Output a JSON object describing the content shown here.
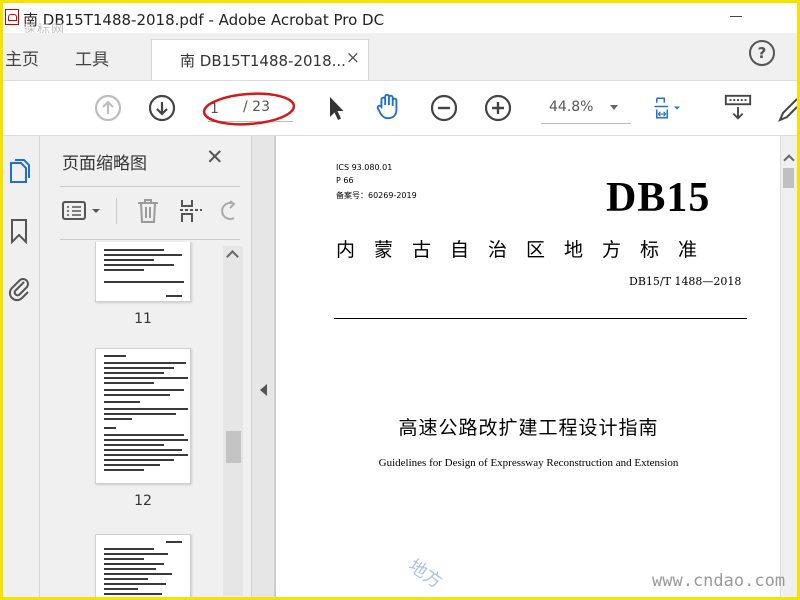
{
  "window": {
    "title": "南 DB15T1488-2018.pdf - Adobe Acrobat Pro DC",
    "watermark_top": "速标网"
  },
  "nav": {
    "home": "主页",
    "tools": "工具",
    "doc_tab": "南 DB15T1488-2018...",
    "doc_tab_close": "×",
    "help": "?"
  },
  "toolbar": {
    "page_current": "1",
    "page_total": "/ 23",
    "zoom": "44.8%"
  },
  "panel": {
    "title": "页面缩略图",
    "close": "✕",
    "thumbnails": [
      {
        "label": "11"
      },
      {
        "label": "12"
      },
      {
        "label": ""
      }
    ]
  },
  "document": {
    "ics": "ICS 93.080.01",
    "p": "P 66",
    "record": "备案号：60269-2019",
    "logo": "DB15",
    "region": "内蒙古自治区地方标准",
    "code": "DB15/T 1488—2018",
    "title_cn": "高速公路改扩建工程设计指南",
    "title_en": "Guidelines for Design of Expressway Reconstruction and Extension"
  },
  "watermark": {
    "site": "www.cndao.com",
    "diag": "地方"
  },
  "colors": {
    "accent_blue": "#1f6fd1",
    "highlight_ellipse": "#d4191a",
    "frame_yellow": "#f5e200"
  }
}
